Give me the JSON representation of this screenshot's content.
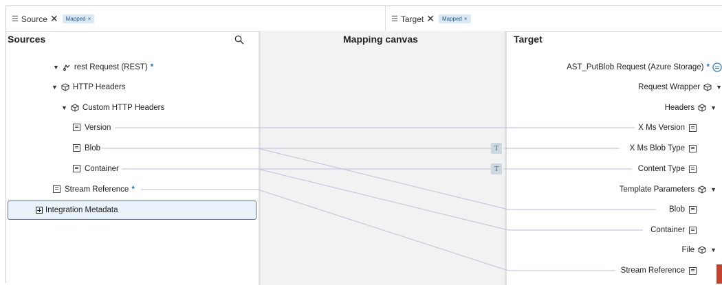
{
  "filters": {
    "source": {
      "label": "Source",
      "chip": "Mapped"
    },
    "target": {
      "label": "Target",
      "chip": "Mapped"
    }
  },
  "headers": {
    "sources": "Sources",
    "canvas": "Mapping canvas",
    "target": "Target"
  },
  "source_tree": {
    "root": "rest Request (REST)",
    "http_headers": "HTTP Headers",
    "custom_http_headers": "Custom HTTP Headers",
    "version": "Version",
    "blob": "Blob",
    "container": "Container",
    "stream_reference": "Stream Reference",
    "integration_metadata": "Integration Metadata"
  },
  "target_tree": {
    "root": "AST_PutBlob Request (Azure Storage)",
    "request_wrapper": "Request Wrapper",
    "headers": "Headers",
    "x_ms_version": "X Ms Version",
    "x_ms_blob_type": "X Ms Blob Type",
    "content_type": "Content Type",
    "template_parameters": "Template Parameters",
    "blob": "Blob",
    "container": "Container",
    "file": "File",
    "stream_reference": "Stream Reference"
  },
  "function_badge": "T",
  "colors": {
    "accent": "#1a76c0",
    "chip_bg": "#dbe9f5",
    "line": "#c4c9e0",
    "selected_bg": "#eaf2fa",
    "status_bar": "#c0452c"
  }
}
